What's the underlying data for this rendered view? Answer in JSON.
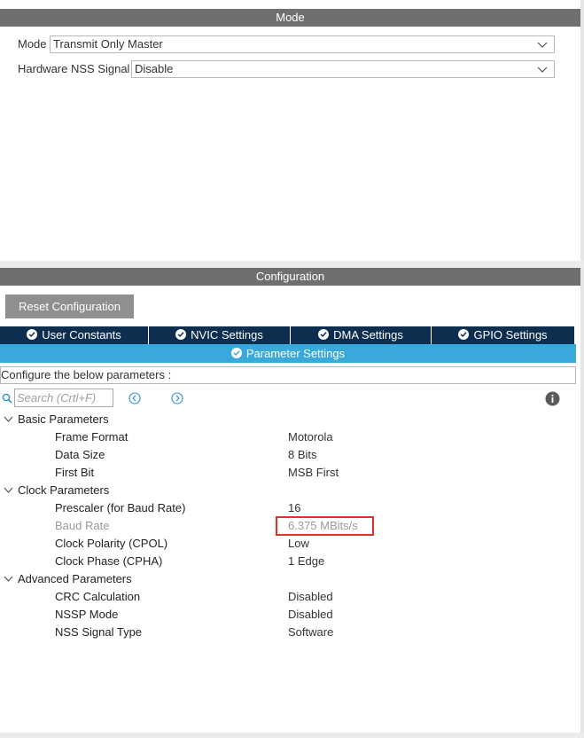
{
  "mode_section": {
    "header": "Mode",
    "fields": [
      {
        "label": "Mode",
        "value": "Transmit Only Master"
      },
      {
        "label": "Hardware NSS Signal",
        "value": "Disable"
      }
    ]
  },
  "configuration_section": {
    "header": "Configuration",
    "reset_label": "Reset Configuration",
    "tabs": [
      {
        "label": "User Constants"
      },
      {
        "label": "NVIC Settings"
      },
      {
        "label": "DMA Settings"
      },
      {
        "label": "GPIO Settings"
      }
    ],
    "active_tab": {
      "label": "Parameter Settings"
    },
    "configure_text": "Configure the below parameters :",
    "search": {
      "placeholder": "Search (Crtl+F)"
    }
  },
  "groups": [
    {
      "title": "Basic Parameters",
      "params": [
        {
          "name": "Frame Format",
          "value": "Motorola"
        },
        {
          "name": "Data Size",
          "value": "8 Bits"
        },
        {
          "name": "First Bit",
          "value": "MSB First"
        }
      ]
    },
    {
      "title": "Clock Parameters",
      "params": [
        {
          "name": "Prescaler (for Baud Rate)",
          "value": "16"
        },
        {
          "name": "Baud Rate",
          "value": "6.375 MBits/s"
        },
        {
          "name": "Clock Polarity (CPOL)",
          "value": "Low"
        },
        {
          "name": "Clock Phase (CPHA)",
          "value": "1 Edge"
        }
      ]
    },
    {
      "title": "Advanced Parameters",
      "params": [
        {
          "name": "CRC Calculation",
          "value": "Disabled"
        },
        {
          "name": "NSSP Mode",
          "value": "Disabled"
        },
        {
          "name": "NSS Signal Type",
          "value": "Software"
        }
      ]
    }
  ],
  "icons": [
    "chevron-down-icon",
    "check-circle-icon",
    "search-icon",
    "arrow-left-circle-icon",
    "arrow-right-circle-icon",
    "info-icon",
    "collapse-chevron-icon"
  ],
  "colors": {
    "tab_dark": "#0d2e4f",
    "tab_active": "#39a9dc",
    "band": "#6f6f6f",
    "highlight": "#e0302a"
  }
}
